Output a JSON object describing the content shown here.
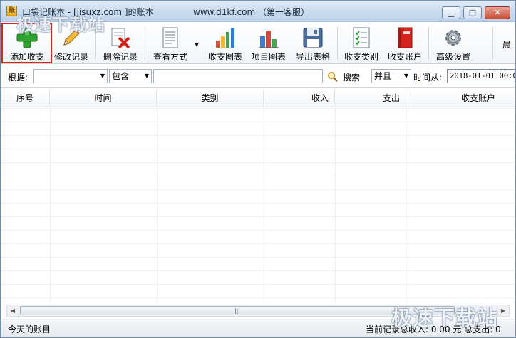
{
  "titlebar": {
    "title": "口袋记账本 - [jisuxz.com ]的账本",
    "website": "www.d1kf.com （第一客服）",
    "minimize_glyph": "▁",
    "maximize_glyph": "□",
    "close_glyph": "✕"
  },
  "watermark": {
    "top": "极速下载站",
    "bottom": "极速下载站"
  },
  "toolbar": {
    "add": "添加收支",
    "edit": "修改记录",
    "delete": "删除记录",
    "view": "查看方式",
    "chart": "收支图表",
    "project_chart": "项目图表",
    "export": "导出表格",
    "category": "收支类别",
    "account": "收支账户",
    "advanced": "高级设置",
    "extra": "晨"
  },
  "filter": {
    "basis_label": "根据:",
    "basis_value": "",
    "mode_value": "包含",
    "search_value": "",
    "search_label": "搜索",
    "logic_value": "并且",
    "time_from_label": "时间从:",
    "time_from_value": "2018-01-01 00:0"
  },
  "grid": {
    "columns": [
      "序号",
      "时间",
      "类别",
      "收入",
      "支出",
      "收支账户"
    ]
  },
  "scrollbar": {
    "left_arrow": "◀",
    "right_arrow": "▶",
    "thumb_grip": "|||"
  },
  "status": {
    "left": "今天的账目",
    "right": "当前记录总收入: 0.00  元  总支出: 0"
  },
  "colors": {
    "highlight_border": "#e0201c",
    "titlebar": "#c8daee"
  }
}
